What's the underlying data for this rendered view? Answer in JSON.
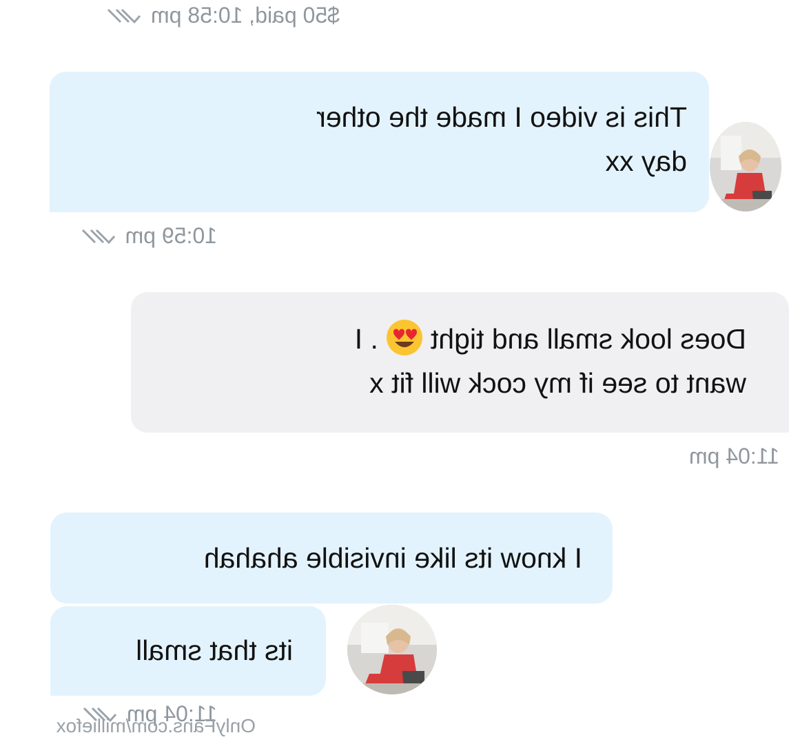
{
  "messages": [
    {
      "id": "m1",
      "direction": "incoming",
      "lines": [
        "This is video I made the other",
        "day xx"
      ],
      "time": "10:59 pm"
    },
    {
      "id": "m2",
      "direction": "outgoing",
      "lines": [
        "Does look small and tight",
        ". I",
        "want to see if my cock will fit x"
      ],
      "emoji": "heart-eyes-emoji",
      "time": "11:04 pm"
    },
    {
      "id": "m3",
      "direction": "incoming",
      "lines": [
        "I know its like invisible ahahah"
      ]
    },
    {
      "id": "m4",
      "direction": "incoming",
      "lines": [
        "its that small"
      ],
      "time": "11:04 pm"
    }
  ],
  "top_status": "$50 paid, 10:58 pm",
  "watermark": "OnlyFans.com/milliefox",
  "colors": {
    "incoming_bubble": "#e3f3fd",
    "outgoing_bubble": "#f0f0f2",
    "timestamp": "#8f979e",
    "read_ticks": "#9aa3ab"
  },
  "icons": [
    "double-check-icon",
    "avatar"
  ]
}
